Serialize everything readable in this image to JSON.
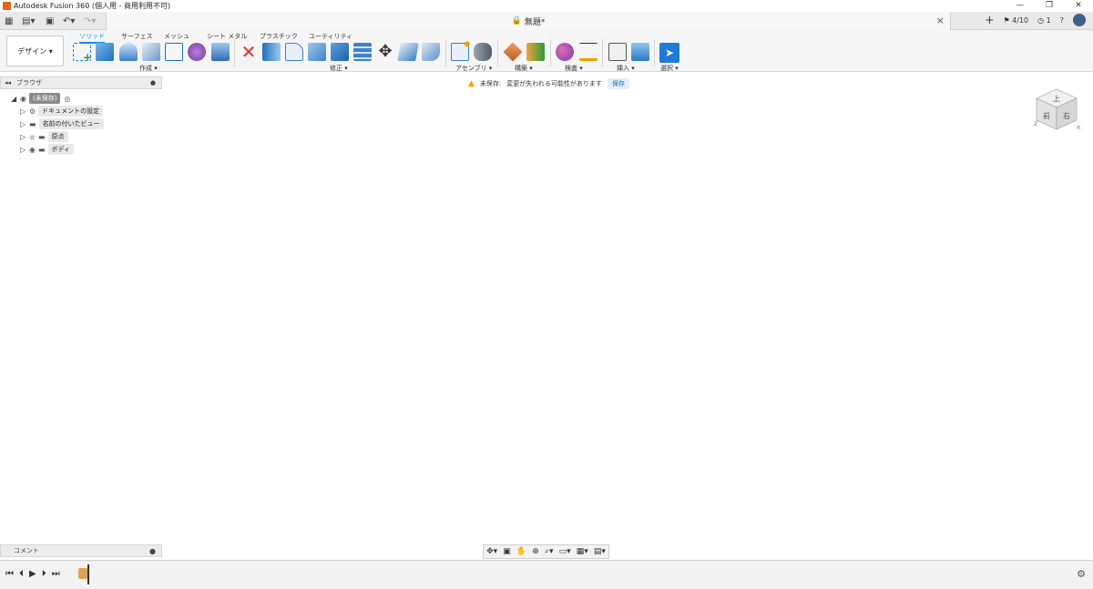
{
  "titlebar": {
    "title": "Autodesk Fusion 360 (個人用 - 商用利用不可)"
  },
  "doc_tab": {
    "title": "無題*"
  },
  "qbar_right": {
    "jobs": "4/10",
    "notifications": "1"
  },
  "workspace": {
    "label": "デザイン ▾"
  },
  "tabs": [
    "ソリッド",
    "サーフェス",
    "メッシュ",
    "シート メタル",
    "プラスチック",
    "ユーティリティ"
  ],
  "groups": [
    "作成 ▾",
    "修正 ▾",
    "アセンブリ ▾",
    "構築 ▾",
    "検査 ▾",
    "挿入 ▾",
    "選択 ▾"
  ],
  "browser": {
    "title": "ブラウザ",
    "root": "(未保存)",
    "nodes": [
      "ドキュメントの設定",
      "名前の付いたビュー",
      "原点",
      "ボディ"
    ]
  },
  "warning": {
    "label": "未保存:",
    "message": "変更が失われる可能性があります",
    "save": "保存"
  },
  "viewcube": {
    "top": "上",
    "front": "前",
    "right": "右"
  },
  "comments": {
    "label": "コメント"
  },
  "colors": {
    "accent": "#0696d7",
    "warning": "#f0a000",
    "mesh": "#6b655a",
    "select": "#1e7ad6"
  }
}
